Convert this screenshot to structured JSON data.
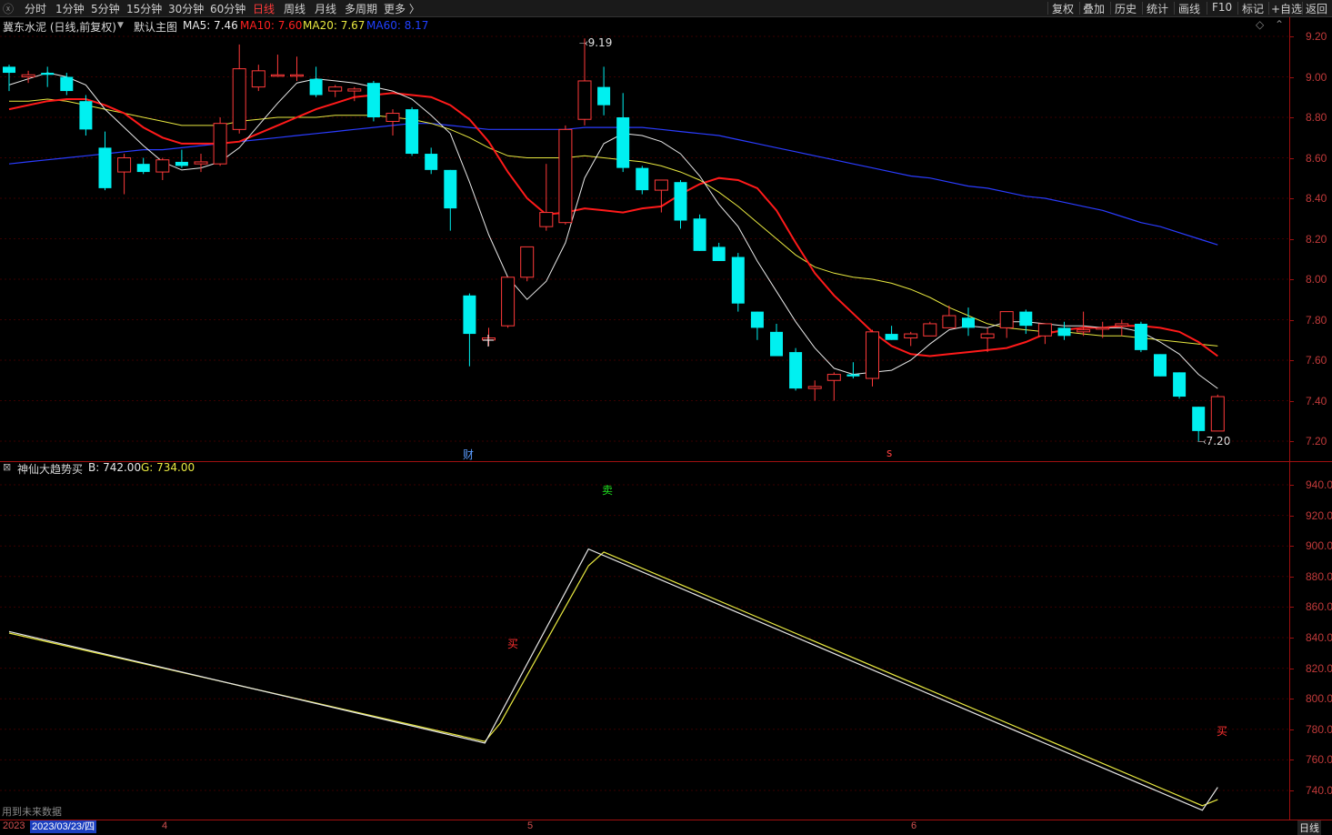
{
  "toolbar": {
    "periods": [
      "分时",
      "1分钟",
      "5分钟",
      "15分钟",
      "30分钟",
      "60分钟",
      "日线",
      "周线",
      "月线",
      "多周期",
      "更多 〉"
    ],
    "active_period": "日线",
    "right": [
      "复权",
      "叠加",
      "历史",
      "统计",
      "画线",
      "F10",
      "标记",
      "+自选",
      "返回"
    ]
  },
  "main_panel": {
    "title": "冀东水泥 (日线,前复权)",
    "template": "默认主图",
    "ma": [
      {
        "label": "MA5: 7.46",
        "color": "#e8e8e8"
      },
      {
        "label": "MA10: 7.60",
        "color": "#ff2020"
      },
      {
        "label": "MA20: 7.67",
        "color": "#e8e840"
      },
      {
        "label": "MA60: 8.17",
        "color": "#2040ff"
      }
    ],
    "high_label": "9.19",
    "low_label": "7.20",
    "marker_cai": "财",
    "marker_s": "s",
    "y_ticks": [
      "9.20",
      "9.00",
      "8.80",
      "8.60",
      "8.40",
      "8.20",
      "8.00",
      "7.80",
      "7.60",
      "7.40",
      "7.20"
    ]
  },
  "sub_panel": {
    "title": "神仙大趋势买",
    "b_label": "B: 742.00",
    "g_label": "G: 734.00",
    "sell_label": "卖",
    "buy_label_1": "买",
    "buy_label_2": "买",
    "footnote": "用到未来数据",
    "y_ticks": [
      "940.00",
      "920.00",
      "900.00",
      "880.00",
      "860.00",
      "840.00",
      "820.00",
      "800.00",
      "780.00",
      "760.00",
      "740.00"
    ]
  },
  "bottom": {
    "date": "2023/03/23/四",
    "year_stub": "2023",
    "months": [
      "4",
      "5",
      "6"
    ],
    "period_label": "日线"
  },
  "chart_data": {
    "type": "candlestick",
    "ylim": [
      7.12,
      9.25
    ],
    "candles": [
      {
        "o": 9.05,
        "h": 9.06,
        "l": 8.93,
        "c": 9.02
      },
      {
        "o": 9.0,
        "h": 9.03,
        "l": 8.97,
        "c": 9.01
      },
      {
        "o": 9.02,
        "h": 9.05,
        "l": 8.95,
        "c": 9.01
      },
      {
        "o": 9.0,
        "h": 9.02,
        "l": 8.91,
        "c": 8.93
      },
      {
        "o": 8.88,
        "h": 8.91,
        "l": 8.71,
        "c": 8.74
      },
      {
        "o": 8.65,
        "h": 8.73,
        "l": 8.44,
        "c": 8.45
      },
      {
        "o": 8.53,
        "h": 8.62,
        "l": 8.42,
        "c": 8.6
      },
      {
        "o": 8.57,
        "h": 8.6,
        "l": 8.52,
        "c": 8.53
      },
      {
        "o": 8.53,
        "h": 8.6,
        "l": 8.49,
        "c": 8.59
      },
      {
        "o": 8.58,
        "h": 8.64,
        "l": 8.55,
        "c": 8.56
      },
      {
        "o": 8.57,
        "h": 8.62,
        "l": 8.53,
        "c": 8.58
      },
      {
        "o": 8.57,
        "h": 8.8,
        "l": 8.56,
        "c": 8.77
      },
      {
        "o": 8.74,
        "h": 9.16,
        "l": 8.72,
        "c": 9.04
      },
      {
        "o": 8.95,
        "h": 9.06,
        "l": 8.93,
        "c": 9.03
      },
      {
        "o": 9.01,
        "h": 9.11,
        "l": 9.0,
        "c": 9.01
      },
      {
        "o": 9.01,
        "h": 9.1,
        "l": 8.98,
        "c": 9.01
      },
      {
        "o": 8.99,
        "h": 9.05,
        "l": 8.9,
        "c": 8.91
      },
      {
        "o": 8.93,
        "h": 8.96,
        "l": 8.9,
        "c": 8.95
      },
      {
        "o": 8.93,
        "h": 8.95,
        "l": 8.88,
        "c": 8.94
      },
      {
        "o": 8.97,
        "h": 8.98,
        "l": 8.78,
        "c": 8.8
      },
      {
        "o": 8.78,
        "h": 8.84,
        "l": 8.71,
        "c": 8.82
      },
      {
        "o": 8.84,
        "h": 8.85,
        "l": 8.61,
        "c": 8.62
      },
      {
        "o": 8.62,
        "h": 8.65,
        "l": 8.52,
        "c": 8.54
      },
      {
        "o": 8.54,
        "h": 8.54,
        "l": 8.24,
        "c": 8.35
      },
      {
        "o": 7.92,
        "h": 7.93,
        "l": 7.57,
        "c": 7.73
      },
      {
        "o": 7.7,
        "h": 7.76,
        "l": 7.67,
        "c": 7.71
      },
      {
        "o": 7.77,
        "h": 8.01,
        "l": 7.76,
        "c": 8.01
      },
      {
        "o": 8.01,
        "h": 8.15,
        "l": 7.99,
        "c": 8.16
      },
      {
        "o": 8.26,
        "h": 8.57,
        "l": 8.24,
        "c": 8.33
      },
      {
        "o": 8.28,
        "h": 8.76,
        "l": 8.27,
        "c": 8.74
      },
      {
        "o": 8.79,
        "h": 9.19,
        "l": 8.76,
        "c": 8.98
      },
      {
        "o": 8.95,
        "h": 9.05,
        "l": 8.81,
        "c": 8.86
      },
      {
        "o": 8.8,
        "h": 8.92,
        "l": 8.53,
        "c": 8.55
      },
      {
        "o": 8.55,
        "h": 8.56,
        "l": 8.42,
        "c": 8.44
      },
      {
        "o": 8.44,
        "h": 8.49,
        "l": 8.33,
        "c": 8.49
      },
      {
        "o": 8.48,
        "h": 8.49,
        "l": 8.25,
        "c": 8.29
      },
      {
        "o": 8.3,
        "h": 8.32,
        "l": 8.14,
        "c": 8.14
      },
      {
        "o": 8.16,
        "h": 8.18,
        "l": 8.1,
        "c": 8.09
      },
      {
        "o": 8.11,
        "h": 8.13,
        "l": 7.84,
        "c": 7.88
      },
      {
        "o": 7.84,
        "h": 7.84,
        "l": 7.7,
        "c": 7.76
      },
      {
        "o": 7.74,
        "h": 7.78,
        "l": 7.62,
        "c": 7.62
      },
      {
        "o": 7.64,
        "h": 7.66,
        "l": 7.45,
        "c": 7.46
      },
      {
        "o": 7.46,
        "h": 7.5,
        "l": 7.4,
        "c": 7.47
      },
      {
        "o": 7.5,
        "h": 7.54,
        "l": 7.4,
        "c": 7.53
      },
      {
        "o": 7.53,
        "h": 7.59,
        "l": 7.51,
        "c": 7.52
      },
      {
        "o": 7.51,
        "h": 7.75,
        "l": 7.47,
        "c": 7.74
      },
      {
        "o": 7.73,
        "h": 7.77,
        "l": 7.7,
        "c": 7.7
      },
      {
        "o": 7.71,
        "h": 7.74,
        "l": 7.67,
        "c": 7.73
      },
      {
        "o": 7.72,
        "h": 7.79,
        "l": 7.72,
        "c": 7.78
      },
      {
        "o": 7.76,
        "h": 7.87,
        "l": 7.76,
        "c": 7.82
      },
      {
        "o": 7.81,
        "h": 7.86,
        "l": 7.72,
        "c": 7.76
      },
      {
        "o": 7.71,
        "h": 7.76,
        "l": 7.64,
        "c": 7.73
      },
      {
        "o": 7.76,
        "h": 7.84,
        "l": 7.71,
        "c": 7.84
      },
      {
        "o": 7.84,
        "h": 7.85,
        "l": 7.73,
        "c": 7.77
      },
      {
        "o": 7.72,
        "h": 7.78,
        "l": 7.68,
        "c": 7.78
      },
      {
        "o": 7.76,
        "h": 7.79,
        "l": 7.7,
        "c": 7.72
      },
      {
        "o": 7.74,
        "h": 7.84,
        "l": 7.72,
        "c": 7.75
      },
      {
        "o": 7.76,
        "h": 7.79,
        "l": 7.71,
        "c": 7.76
      },
      {
        "o": 7.77,
        "h": 7.8,
        "l": 7.72,
        "c": 7.78
      },
      {
        "o": 7.78,
        "h": 7.79,
        "l": 7.64,
        "c": 7.65
      },
      {
        "o": 7.63,
        "h": 7.63,
        "l": 7.52,
        "c": 7.52
      },
      {
        "o": 7.54,
        "h": 7.54,
        "l": 7.41,
        "c": 7.42
      },
      {
        "o": 7.37,
        "h": 7.37,
        "l": 7.2,
        "c": 7.25
      },
      {
        "o": 7.25,
        "h": 7.43,
        "l": 7.25,
        "c": 7.42
      }
    ],
    "ma5": [
      8.96,
      8.99,
      9.02,
      9.0,
      8.96,
      8.84,
      8.75,
      8.66,
      8.58,
      8.54,
      8.55,
      8.58,
      8.65,
      8.76,
      8.87,
      8.97,
      8.99,
      8.98,
      8.97,
      8.95,
      8.93,
      8.89,
      8.81,
      8.72,
      8.48,
      8.22,
      8.01,
      7.9,
      7.99,
      8.18,
      8.5,
      8.67,
      8.72,
      8.71,
      8.68,
      8.62,
      8.51,
      8.37,
      8.26,
      8.09,
      7.94,
      7.79,
      7.66,
      7.56,
      7.53,
      7.54,
      7.55,
      7.6,
      7.68,
      7.75,
      7.77,
      7.76,
      7.79,
      7.79,
      7.78,
      7.77,
      7.77,
      7.76,
      7.76,
      7.74,
      7.69,
      7.63,
      7.53,
      7.46
    ],
    "ma10": [
      8.84,
      8.86,
      8.88,
      8.89,
      8.89,
      8.86,
      8.82,
      8.75,
      8.7,
      8.67,
      8.67,
      8.67,
      8.68,
      8.72,
      8.76,
      8.8,
      8.84,
      8.87,
      8.9,
      8.91,
      8.92,
      8.91,
      8.9,
      8.86,
      8.79,
      8.68,
      8.53,
      8.4,
      8.32,
      8.33,
      8.35,
      8.34,
      8.33,
      8.35,
      8.36,
      8.42,
      8.47,
      8.5,
      8.49,
      8.45,
      8.34,
      8.18,
      8.03,
      7.92,
      7.83,
      7.74,
      7.67,
      7.63,
      7.62,
      7.63,
      7.64,
      7.65,
      7.66,
      7.69,
      7.73,
      7.75,
      7.76,
      7.76,
      7.77,
      7.77,
      7.76,
      7.74,
      7.69,
      7.62
    ],
    "ma20": [
      8.88,
      8.88,
      8.89,
      8.88,
      8.86,
      8.84,
      8.82,
      8.8,
      8.78,
      8.76,
      8.76,
      8.76,
      8.78,
      8.79,
      8.8,
      8.8,
      8.8,
      8.81,
      8.81,
      8.81,
      8.8,
      8.79,
      8.77,
      8.74,
      8.7,
      8.65,
      8.61,
      8.6,
      8.6,
      8.6,
      8.61,
      8.6,
      8.59,
      8.58,
      8.56,
      8.53,
      8.49,
      8.43,
      8.36,
      8.28,
      8.2,
      8.12,
      8.06,
      8.03,
      8.01,
      8.0,
      7.98,
      7.95,
      7.91,
      7.86,
      7.82,
      7.78,
      7.76,
      7.75,
      7.74,
      7.74,
      7.73,
      7.72,
      7.72,
      7.71,
      7.7,
      7.69,
      7.68,
      7.67
    ],
    "ma60": [
      8.57,
      8.58,
      8.59,
      8.6,
      8.61,
      8.62,
      8.63,
      8.64,
      8.64,
      8.65,
      8.66,
      8.67,
      8.68,
      8.69,
      8.7,
      8.71,
      8.72,
      8.73,
      8.74,
      8.75,
      8.76,
      8.77,
      8.77,
      8.76,
      8.75,
      8.74,
      8.74,
      8.74,
      8.74,
      8.74,
      8.75,
      8.75,
      8.75,
      8.75,
      8.74,
      8.73,
      8.72,
      8.71,
      8.69,
      8.67,
      8.65,
      8.63,
      8.61,
      8.59,
      8.57,
      8.55,
      8.53,
      8.51,
      8.5,
      8.48,
      8.46,
      8.45,
      8.43,
      8.41,
      8.4,
      8.38,
      8.36,
      8.34,
      8.31,
      8.28,
      8.26,
      8.23,
      8.2,
      8.17
    ],
    "sub_ylim": [
      726,
      948
    ],
    "sub_white": [
      {
        "i": 0,
        "v": 844
      },
      {
        "i": 24.8,
        "v": 771
      },
      {
        "i": 30.2,
        "v": 898
      },
      {
        "i": 62.2,
        "v": 727
      },
      {
        "i": 63,
        "v": 742
      }
    ],
    "sub_yellow": [
      {
        "i": 0,
        "v": 843
      },
      {
        "i": 24.8,
        "v": 772
      },
      {
        "i": 25.6,
        "v": 784
      },
      {
        "i": 30.2,
        "v": 887
      },
      {
        "i": 31,
        "v": 896
      },
      {
        "i": 62.2,
        "v": 730
      },
      {
        "i": 63,
        "v": 734
      }
    ]
  }
}
